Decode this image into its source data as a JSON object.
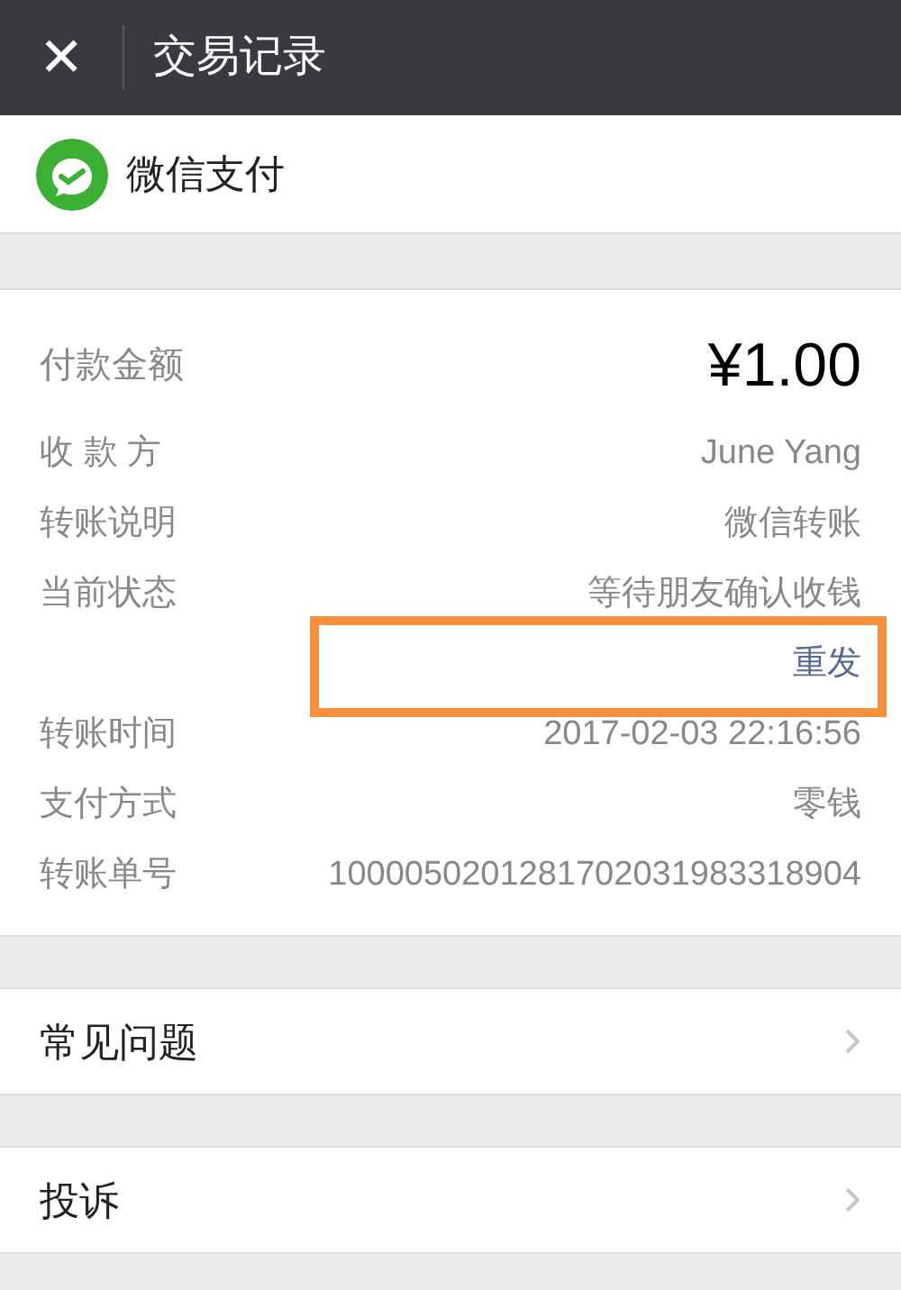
{
  "header": {
    "close": "✕",
    "title": "交易记录"
  },
  "brand": {
    "name": "微信支付"
  },
  "amount": {
    "label": "付款金额",
    "value": "¥1.00"
  },
  "details": [
    {
      "label": "收 款 方",
      "value": "June Yang",
      "kind": "text"
    },
    {
      "label": "转账说明",
      "value": "微信转账",
      "kind": "text"
    },
    {
      "label": "当前状态",
      "value": "等待朋友确认收钱",
      "kind": "text"
    },
    {
      "value": "重发",
      "kind": "link"
    },
    {
      "label": "转账时间",
      "value": "2017-02-03 22:16:56",
      "kind": "text"
    },
    {
      "label": "支付方式",
      "value": "零钱",
      "kind": "text"
    },
    {
      "label": "转账单号",
      "value": "1000050201281702031983318904",
      "kind": "text"
    }
  ],
  "menu": [
    {
      "label": "常见问题"
    },
    {
      "label": "投诉"
    }
  ]
}
